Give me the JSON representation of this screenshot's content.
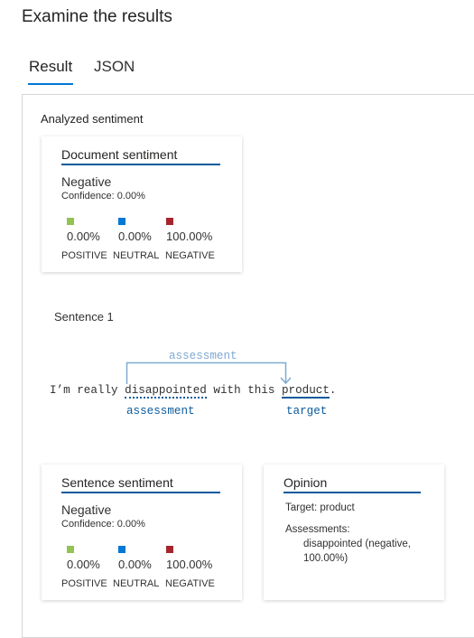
{
  "header": {
    "title": "Examine the results"
  },
  "tabs": [
    {
      "label": "Result",
      "active": true
    },
    {
      "label": "JSON",
      "active": false
    }
  ],
  "section_title": "Analyzed sentiment",
  "colors": {
    "positive": "#92c353",
    "neutral": "#0078d4",
    "negative": "#a4262c",
    "accent": "#0b5a9c"
  },
  "document": {
    "title": "Document sentiment",
    "sentiment": "Negative",
    "confidence": "Confidence: 0.00%",
    "scores": [
      {
        "value": "0.00%",
        "label": "POSITIVE"
      },
      {
        "value": "0.00%",
        "label": "NEUTRAL"
      },
      {
        "value": "100.00%",
        "label": "NEGATIVE"
      }
    ]
  },
  "sentence_label": "Sentence 1",
  "sentence": {
    "pre": "I’m really ",
    "assessment_word": "disappointed",
    "mid": " with this ",
    "target_word": "product",
    "post": ".",
    "relation_label": "assessment",
    "assessment_tag": "assessment",
    "target_tag": "target"
  },
  "sentence_sentiment": {
    "title": "Sentence sentiment",
    "sentiment": "Negative",
    "confidence": "Confidence: 0.00%",
    "scores": [
      {
        "value": "0.00%",
        "label": "POSITIVE"
      },
      {
        "value": "0.00%",
        "label": "NEUTRAL"
      },
      {
        "value": "100.00%",
        "label": "NEGATIVE"
      }
    ]
  },
  "opinion": {
    "title": "Opinion",
    "target_label": "Target:",
    "target": "product",
    "assessments_label": "Assessments:",
    "assessment_line1": "disappointed (negative,",
    "assessment_line2": "100.00%)"
  }
}
